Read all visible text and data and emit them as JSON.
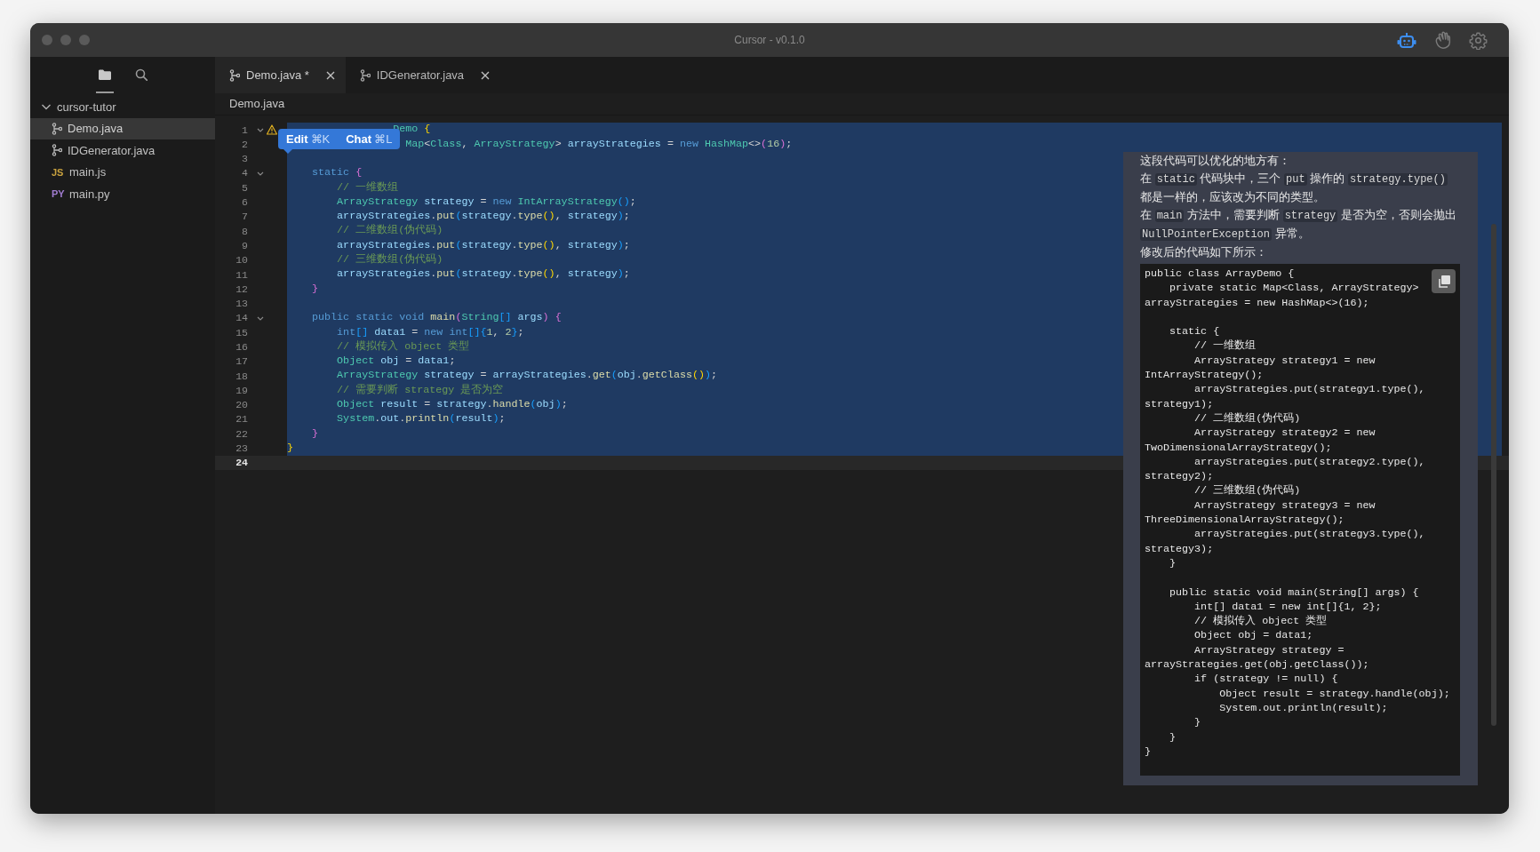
{
  "window": {
    "title": "Cursor - v0.1.0"
  },
  "toolbar": [
    {
      "kind": "robot",
      "selected": true
    },
    {
      "kind": "hand",
      "selected": false
    },
    {
      "kind": "settings",
      "selected": false
    }
  ],
  "sidebar": {
    "views": [
      {
        "kind": "files",
        "selected": true
      },
      {
        "kind": "search",
        "selected": false
      }
    ],
    "tree": [
      {
        "name": "cursor-tutor",
        "expanded": true,
        "children": [
          {
            "name": "Demo.java",
            "kind": "git",
            "selected": true
          },
          {
            "name": "IDGenerator.java",
            "kind": "git",
            "selected": false
          },
          {
            "name": "main.js",
            "kind": "badge",
            "badge": "JS",
            "color": "#c9a23f",
            "selected": false
          },
          {
            "name": "main.py",
            "kind": "badge",
            "badge": "PY",
            "color": "#a07cd0",
            "selected": false
          }
        ]
      }
    ]
  },
  "tabs": [
    {
      "label": "Demo.java *",
      "selected": true
    },
    {
      "label": "IDGenerator.java",
      "selected": false
    }
  ],
  "breadcrumb": "Demo.java",
  "editor": {
    "lines": [
      {
        "number": "1",
        "fold": true,
        "warning": true,
        "selected": true,
        "current": false,
        "tokens": [
          {
            "text": "                 Demo",
            "kind": "type"
          },
          {
            "text": " {",
            "kind": "b1"
          }
        ]
      },
      {
        "number": "2",
        "fold": false,
        "warning": false,
        "selected": true,
        "current": false,
        "tokens": [
          {
            "text": "                   Map",
            "kind": "type"
          },
          {
            "text": "<",
            "kind": "p"
          },
          {
            "text": "Class",
            "kind": "type"
          },
          {
            "text": ", ",
            "kind": "p"
          },
          {
            "text": "ArrayStrategy",
            "kind": "type"
          },
          {
            "text": "> ",
            "kind": "p"
          },
          {
            "text": "arrayStrategies",
            "kind": "var"
          },
          {
            "text": " = ",
            "kind": "p"
          },
          {
            "text": "new",
            "kind": "kw"
          },
          {
            "text": " HashMap",
            "kind": "type"
          },
          {
            "text": "<>",
            "kind": "p"
          },
          {
            "text": "(",
            "kind": "b2"
          },
          {
            "text": "16",
            "kind": "num"
          },
          {
            "text": ")",
            "kind": "b2"
          },
          {
            "text": ";",
            "kind": "p"
          }
        ]
      },
      {
        "number": "3",
        "fold": false,
        "warning": false,
        "selected": true,
        "current": false
      },
      {
        "number": "4",
        "fold": true,
        "warning": false,
        "selected": true,
        "current": false,
        "tokens": [
          {
            "text": "    static",
            "kind": "kw"
          },
          {
            "text": " {",
            "kind": "b2"
          }
        ]
      },
      {
        "number": "5",
        "fold": false,
        "warning": false,
        "selected": true,
        "current": false,
        "tokens": [
          {
            "text": "        // 一维数组",
            "kind": "c"
          }
        ]
      },
      {
        "number": "6",
        "fold": false,
        "warning": false,
        "selected": true,
        "current": false,
        "tokens": [
          {
            "text": "        ArrayStrategy",
            "kind": "type"
          },
          {
            "text": " strategy",
            "kind": "var"
          },
          {
            "text": " = ",
            "kind": "p"
          },
          {
            "text": "new",
            "kind": "kw"
          },
          {
            "text": " IntArrayStrategy",
            "kind": "type"
          },
          {
            "text": "()",
            "kind": "b3"
          },
          {
            "text": ";",
            "kind": "p"
          }
        ]
      },
      {
        "number": "7",
        "fold": false,
        "warning": false,
        "selected": true,
        "current": false,
        "tokens": [
          {
            "text": "        arrayStrategies",
            "kind": "var"
          },
          {
            "text": ".",
            "kind": "p"
          },
          {
            "text": "put",
            "kind": "fn"
          },
          {
            "text": "(",
            "kind": "b3"
          },
          {
            "text": "strategy",
            "kind": "var"
          },
          {
            "text": ".",
            "kind": "p"
          },
          {
            "text": "type",
            "kind": "fn"
          },
          {
            "text": "()",
            "kind": "b1"
          },
          {
            "text": ", ",
            "kind": "p"
          },
          {
            "text": "strategy",
            "kind": "var"
          },
          {
            "text": ")",
            "kind": "b3"
          },
          {
            "text": ";",
            "kind": "p"
          }
        ]
      },
      {
        "number": "8",
        "fold": false,
        "warning": false,
        "selected": true,
        "current": false,
        "tokens": [
          {
            "text": "        // 二维数组(伪代码)",
            "kind": "c"
          }
        ]
      },
      {
        "number": "9",
        "fold": false,
        "warning": false,
        "selected": true,
        "current": false,
        "tokens": [
          {
            "text": "        arrayStrategies",
            "kind": "var"
          },
          {
            "text": ".",
            "kind": "p"
          },
          {
            "text": "put",
            "kind": "fn"
          },
          {
            "text": "(",
            "kind": "b3"
          },
          {
            "text": "strategy",
            "kind": "var"
          },
          {
            "text": ".",
            "kind": "p"
          },
          {
            "text": "type",
            "kind": "fn"
          },
          {
            "text": "()",
            "kind": "b1"
          },
          {
            "text": ", ",
            "kind": "p"
          },
          {
            "text": "strategy",
            "kind": "var"
          },
          {
            "text": ")",
            "kind": "b3"
          },
          {
            "text": ";",
            "kind": "p"
          }
        ]
      },
      {
        "number": "10",
        "fold": false,
        "warning": false,
        "selected": true,
        "current": false,
        "tokens": [
          {
            "text": "        // 三维数组(伪代码)",
            "kind": "c"
          }
        ]
      },
      {
        "number": "11",
        "fold": false,
        "warning": false,
        "selected": true,
        "current": false,
        "tokens": [
          {
            "text": "        arrayStrategies",
            "kind": "var"
          },
          {
            "text": ".",
            "kind": "p"
          },
          {
            "text": "put",
            "kind": "fn"
          },
          {
            "text": "(",
            "kind": "b3"
          },
          {
            "text": "strategy",
            "kind": "var"
          },
          {
            "text": ".",
            "kind": "p"
          },
          {
            "text": "type",
            "kind": "fn"
          },
          {
            "text": "()",
            "kind": "b1"
          },
          {
            "text": ", ",
            "kind": "p"
          },
          {
            "text": "strategy",
            "kind": "var"
          },
          {
            "text": ")",
            "kind": "b3"
          },
          {
            "text": ";",
            "kind": "p"
          }
        ]
      },
      {
        "number": "12",
        "fold": false,
        "warning": false,
        "selected": true,
        "current": false,
        "tokens": [
          {
            "text": "    }",
            "kind": "b2"
          }
        ]
      },
      {
        "number": "13",
        "fold": false,
        "warning": false,
        "selected": true,
        "current": false
      },
      {
        "number": "14",
        "fold": true,
        "warning": false,
        "selected": true,
        "current": false,
        "tokens": [
          {
            "text": "    public static void",
            "kind": "kw"
          },
          {
            "text": " main",
            "kind": "fn"
          },
          {
            "text": "(",
            "kind": "b2"
          },
          {
            "text": "String",
            "kind": "type"
          },
          {
            "text": "[]",
            "kind": "b3"
          },
          {
            "text": " args",
            "kind": "var"
          },
          {
            "text": ")",
            "kind": "b2"
          },
          {
            "text": " {",
            "kind": "b2"
          }
        ]
      },
      {
        "number": "15",
        "fold": false,
        "warning": false,
        "selected": true,
        "current": false,
        "tokens": [
          {
            "text": "        int",
            "kind": "kw"
          },
          {
            "text": "[]",
            "kind": "b3"
          },
          {
            "text": " data1",
            "kind": "var"
          },
          {
            "text": " = ",
            "kind": "p"
          },
          {
            "text": "new",
            "kind": "kw"
          },
          {
            "text": " int",
            "kind": "kw"
          },
          {
            "text": "[]",
            "kind": "b3"
          },
          {
            "text": "{",
            "kind": "b3"
          },
          {
            "text": "1",
            "kind": "num"
          },
          {
            "text": ", ",
            "kind": "p"
          },
          {
            "text": "2",
            "kind": "num"
          },
          {
            "text": "}",
            "kind": "b3"
          },
          {
            "text": ";",
            "kind": "p"
          }
        ]
      },
      {
        "number": "16",
        "fold": false,
        "warning": false,
        "selected": true,
        "current": false,
        "tokens": [
          {
            "text": "        // 模拟传入 object 类型",
            "kind": "c"
          }
        ]
      },
      {
        "number": "17",
        "fold": false,
        "warning": false,
        "selected": true,
        "current": false,
        "tokens": [
          {
            "text": "        Object",
            "kind": "type"
          },
          {
            "text": " obj",
            "kind": "var"
          },
          {
            "text": " = ",
            "kind": "p"
          },
          {
            "text": "data1",
            "kind": "var"
          },
          {
            "text": ";",
            "kind": "p"
          }
        ]
      },
      {
        "number": "18",
        "fold": false,
        "warning": false,
        "selected": true,
        "current": false,
        "tokens": [
          {
            "text": "        ArrayStrategy",
            "kind": "type"
          },
          {
            "text": " strategy",
            "kind": "var"
          },
          {
            "text": " = ",
            "kind": "p"
          },
          {
            "text": "arrayStrategies",
            "kind": "var"
          },
          {
            "text": ".",
            "kind": "p"
          },
          {
            "text": "get",
            "kind": "fn"
          },
          {
            "text": "(",
            "kind": "b3"
          },
          {
            "text": "obj",
            "kind": "var"
          },
          {
            "text": ".",
            "kind": "p"
          },
          {
            "text": "getClass",
            "kind": "fn"
          },
          {
            "text": "()",
            "kind": "b1"
          },
          {
            "text": ")",
            "kind": "b3"
          },
          {
            "text": ";",
            "kind": "p"
          }
        ]
      },
      {
        "number": "19",
        "fold": false,
        "warning": false,
        "selected": true,
        "current": false,
        "tokens": [
          {
            "text": "        // 需要判断 strategy 是否为空",
            "kind": "c"
          }
        ]
      },
      {
        "number": "20",
        "fold": false,
        "warning": false,
        "selected": true,
        "current": false,
        "tokens": [
          {
            "text": "        Object",
            "kind": "type"
          },
          {
            "text": " result",
            "kind": "var"
          },
          {
            "text": " = ",
            "kind": "p"
          },
          {
            "text": "strategy",
            "kind": "var"
          },
          {
            "text": ".",
            "kind": "p"
          },
          {
            "text": "handle",
            "kind": "fn"
          },
          {
            "text": "(",
            "kind": "b3"
          },
          {
            "text": "obj",
            "kind": "var"
          },
          {
            "text": ")",
            "kind": "b3"
          },
          {
            "text": ";",
            "kind": "p"
          }
        ]
      },
      {
        "number": "21",
        "fold": false,
        "warning": false,
        "selected": true,
        "current": false,
        "tokens": [
          {
            "text": "        System",
            "kind": "type"
          },
          {
            "text": ".",
            "kind": "p"
          },
          {
            "text": "out",
            "kind": "var"
          },
          {
            "text": ".",
            "kind": "p"
          },
          {
            "text": "println",
            "kind": "fn"
          },
          {
            "text": "(",
            "kind": "b3"
          },
          {
            "text": "result",
            "kind": "var"
          },
          {
            "text": ")",
            "kind": "b3"
          },
          {
            "text": ";",
            "kind": "p"
          }
        ]
      },
      {
        "number": "22",
        "fold": false,
        "warning": false,
        "selected": true,
        "current": false,
        "tokens": [
          {
            "text": "    }",
            "kind": "b2"
          }
        ]
      },
      {
        "number": "23",
        "fold": false,
        "warning": false,
        "selected": true,
        "current": false,
        "tokens": [
          {
            "text": "}",
            "kind": "b1"
          }
        ]
      },
      {
        "number": "24",
        "fold": false,
        "warning": false,
        "selected": false,
        "current": true
      }
    ]
  },
  "inline_menu": [
    {
      "label": "Edit",
      "shortcut": "⌘K"
    },
    {
      "label": "Chat",
      "shortcut": "⌘L"
    }
  ],
  "chat": {
    "paragraphs": [
      [
        {
          "kind": "text",
          "text": "这段代码可以优化的地方有："
        }
      ],
      [
        {
          "kind": "text",
          "text": "在 "
        },
        {
          "kind": "code",
          "text": "static"
        },
        {
          "kind": "text",
          "text": " 代码块中，三个 "
        },
        {
          "kind": "code",
          "text": "put"
        },
        {
          "kind": "text",
          "text": " 操作的 "
        },
        {
          "kind": "code",
          "text": "strategy.type()"
        },
        {
          "kind": "text",
          "text": " 都是一样的，应该改为不同的类型。"
        }
      ],
      [
        {
          "kind": "text",
          "text": "在 "
        },
        {
          "kind": "code",
          "text": "main"
        },
        {
          "kind": "text",
          "text": " 方法中，需要判断 "
        },
        {
          "kind": "code",
          "text": "strategy"
        },
        {
          "kind": "text",
          "text": " 是否为空，否则会抛出 "
        },
        {
          "kind": "code",
          "text": "NullPointerException"
        },
        {
          "kind": "text",
          "text": " 异常。"
        }
      ],
      [
        {
          "kind": "text",
          "text": "修改后的代码如下所示："
        }
      ]
    ],
    "code": "public class ArrayDemo {\n    private static Map<Class, ArrayStrategy>\narrayStrategies = new HashMap<>(16);\n\n    static {\n        // 一维数组\n        ArrayStrategy strategy1 = new\nIntArrayStrategy();\n        arrayStrategies.put(strategy1.type(),\nstrategy1);\n        // 二维数组(伪代码)\n        ArrayStrategy strategy2 = new\nTwoDimensionalArrayStrategy();\n        arrayStrategies.put(strategy2.type(),\nstrategy2);\n        // 三维数组(伪代码)\n        ArrayStrategy strategy3 = new\nThreeDimensionalArrayStrategy();\n        arrayStrategies.put(strategy3.type(),\nstrategy3);\n    }\n\n    public static void main(String[] args) {\n        int[] data1 = new int[]{1, 2};\n        // 模拟传入 object 类型\n        Object obj = data1;\n        ArrayStrategy strategy =\narrayStrategies.get(obj.getClass());\n        if (strategy != null) {\n            Object result = strategy.handle(obj);\n            System.out.println(result);\n        }\n    }\n}"
  }
}
